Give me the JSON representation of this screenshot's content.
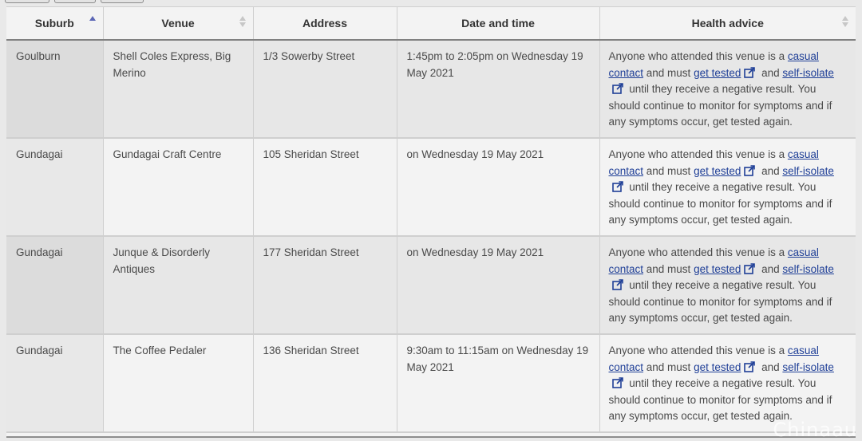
{
  "table": {
    "columns": [
      {
        "label": "Suburb"
      },
      {
        "label": "Venue"
      },
      {
        "label": "Address"
      },
      {
        "label": "Date and time"
      },
      {
        "label": "Health advice"
      }
    ],
    "sorted_column": "Suburb",
    "rows": [
      {
        "suburb": "Goulburn",
        "venue": "Shell Coles Express, Big Merino",
        "address": "1/3 Sowerby Street",
        "datetime": "1:45pm to 2:05pm on Wednesday 19 May 2021"
      },
      {
        "suburb": "Gundagai",
        "venue": "Gundagai Craft Centre",
        "address": "105 Sheridan Street",
        "datetime": "on Wednesday 19 May 2021"
      },
      {
        "suburb": "Gundagai",
        "venue": "Junque & Disorderly Antiques",
        "address": "177 Sheridan Street",
        "datetime": "on Wednesday 19 May 2021"
      },
      {
        "suburb": "Gundagai",
        "venue": "The Coffee Pedaler",
        "address": "136 Sheridan Street",
        "datetime": "9:30am to 11:15am on Wednesday 19 May 2021"
      }
    ],
    "advice": {
      "part1": "Anyone who attended this venue is a ",
      "link_casual": "casual contact",
      "part2": " and must ",
      "link_get_tested": "get tested",
      "part3": " and ",
      "link_self_isolate": "self-isolate",
      "part4": " until they receive a negative result. You should continue to monitor for symptoms and if any symptoms occur, get tested again."
    }
  },
  "watermark": "Chinaau",
  "colors": {
    "link": "#1f3f97",
    "sort_active": "#5b66b5"
  }
}
